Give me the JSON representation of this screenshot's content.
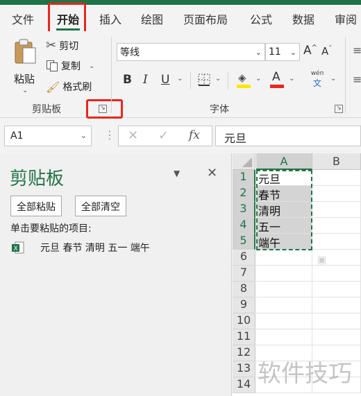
{
  "tabs": [
    "文件",
    "开始",
    "插入",
    "绘图",
    "页面布局",
    "公式",
    "数据",
    "审阅"
  ],
  "clipboard_group": {
    "paste": "粘贴",
    "cut": "剪切",
    "copy": "复制",
    "format_painter": "格式刷",
    "label": "剪贴板"
  },
  "font_group": {
    "font_name": "等线",
    "font_size": "11",
    "label": "字体",
    "grow": "A",
    "shrink": "A",
    "bold": "B",
    "italic": "I",
    "underline": "U",
    "font_color_letter": "A",
    "wen_label": "wén",
    "wen_char": "文",
    "accent_color": "#217346",
    "highlight_color": "#ffe600",
    "font_color": "#e8261d"
  },
  "formula_bar": {
    "name_box": "A1",
    "fx": "fx",
    "formula": "元旦"
  },
  "clipboard_pane": {
    "title": "剪贴板",
    "paste_all": "全部粘贴",
    "clear_all": "全部清空",
    "hint": "单击要粘贴的项目:",
    "item_text": "元旦 春节 清明 五一 端午"
  },
  "sheet": {
    "columns": [
      "A",
      "B"
    ],
    "rows": [
      "1",
      "2",
      "3",
      "4",
      "5",
      "6",
      "7",
      "8",
      "9",
      "10",
      "11",
      "12",
      "13",
      "14"
    ],
    "col_a_values": [
      "元旦",
      "春节",
      "清明",
      "五一",
      "端午"
    ]
  },
  "watermark": "软件技巧"
}
